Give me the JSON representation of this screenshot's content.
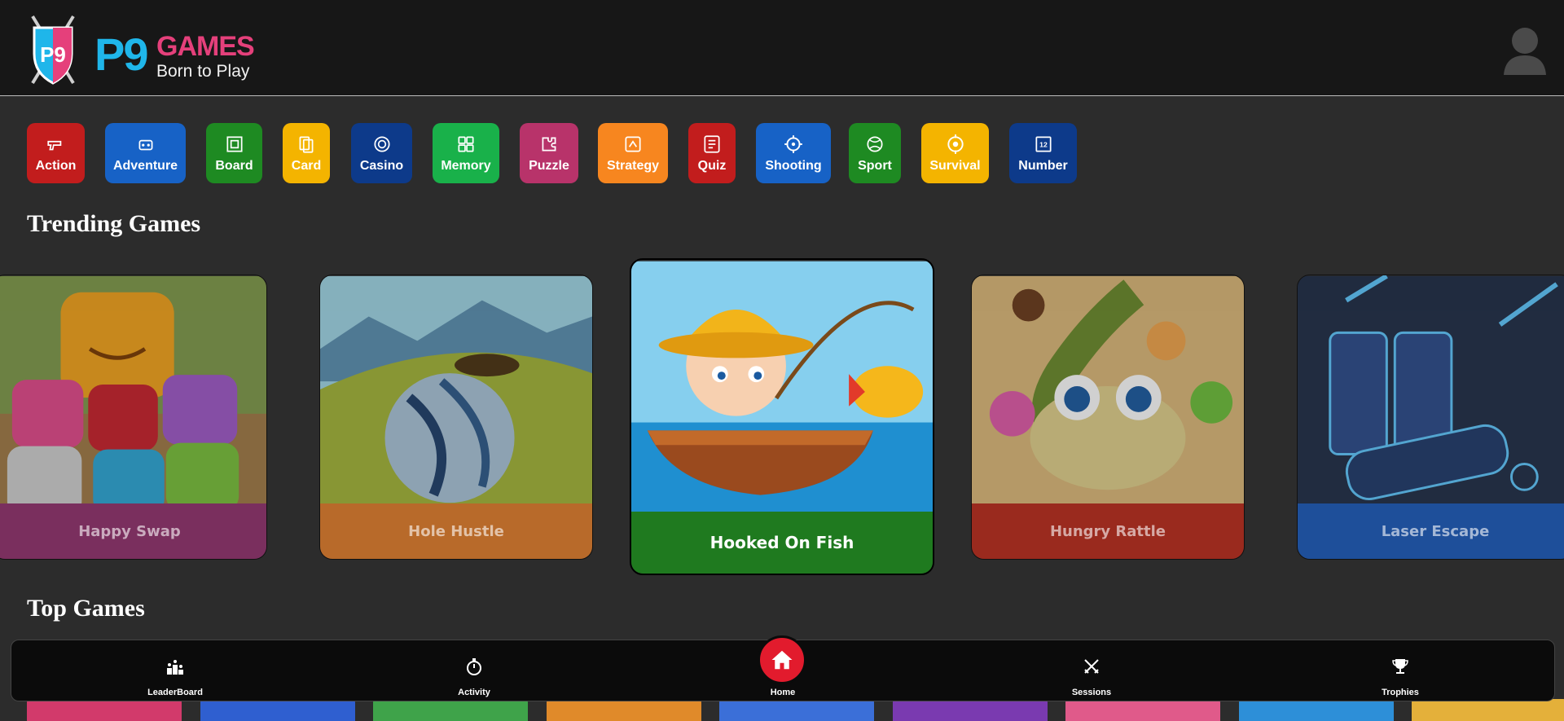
{
  "header": {
    "logo_mark": "P9",
    "logo_name": "GAMES",
    "logo_tagline": "Born to Play"
  },
  "categories": [
    {
      "label": "Action",
      "color": "#c21d1d",
      "icon": "gun-icon"
    },
    {
      "label": "Adventure",
      "color": "#1762c6",
      "icon": "robot-icon"
    },
    {
      "label": "Board",
      "color": "#1e8a22",
      "icon": "board-game-icon"
    },
    {
      "label": "Card",
      "color": "#f4b400",
      "icon": "playing-cards-icon"
    },
    {
      "label": "Casino",
      "color": "#0d3a8a",
      "icon": "casino-chip-icon"
    },
    {
      "label": "Memory",
      "color": "#19b14a",
      "icon": "memory-grid-icon"
    },
    {
      "label": "Puzzle",
      "color": "#b8336a",
      "icon": "puzzle-icon"
    },
    {
      "label": "Strategy",
      "color": "#f7861f",
      "icon": "strategy-icon"
    },
    {
      "label": "Quiz",
      "color": "#c21d1d",
      "icon": "quiz-icon"
    },
    {
      "label": "Shooting",
      "color": "#1762c6",
      "icon": "crosshair-icon"
    },
    {
      "label": "Sport",
      "color": "#1e8a22",
      "icon": "ball-icon"
    },
    {
      "label": "Survival",
      "color": "#f4b400",
      "icon": "target-icon"
    },
    {
      "label": "Number",
      "color": "#0d3a8a",
      "icon": "numbers-icon"
    }
  ],
  "trending": {
    "title": "Trending Games",
    "games": [
      {
        "name": "Happy Swap",
        "label_color": "#7a2f5e",
        "art_color": "#6c8a3a"
      },
      {
        "name": "Hole Hustle",
        "label_color": "#b86a2a",
        "art_color": "#7fa33a"
      },
      {
        "name": "Hooked On Fish",
        "label_color": "#1f7a1f",
        "art_color": "#58b6e0"
      },
      {
        "name": "Hungry Rattle",
        "label_color": "#9a2a1e",
        "art_color": "#d9b26a"
      },
      {
        "name": "Laser Escape",
        "label_color": "#1e4f9a",
        "art_color": "#1b2a4a"
      }
    ]
  },
  "top_games": {
    "title": "Top Games",
    "strip_colors": [
      "#d23a6b",
      "#2f5fd0",
      "#3fa34a",
      "#e08a2a",
      "#3b6fd8",
      "#7a3ab0",
      "#e05a8a",
      "#2d8fd8",
      "#e4b03a"
    ]
  },
  "bottom_nav": {
    "items": [
      {
        "label": "LeaderBoard",
        "icon": "podium-icon"
      },
      {
        "label": "Activity",
        "icon": "stopwatch-icon"
      },
      {
        "label": "Home",
        "icon": "home-icon"
      },
      {
        "label": "Sessions",
        "icon": "crossed-swords-icon"
      },
      {
        "label": "Trophies",
        "icon": "trophy-icon"
      }
    ],
    "active_color": "#e21b2d"
  }
}
